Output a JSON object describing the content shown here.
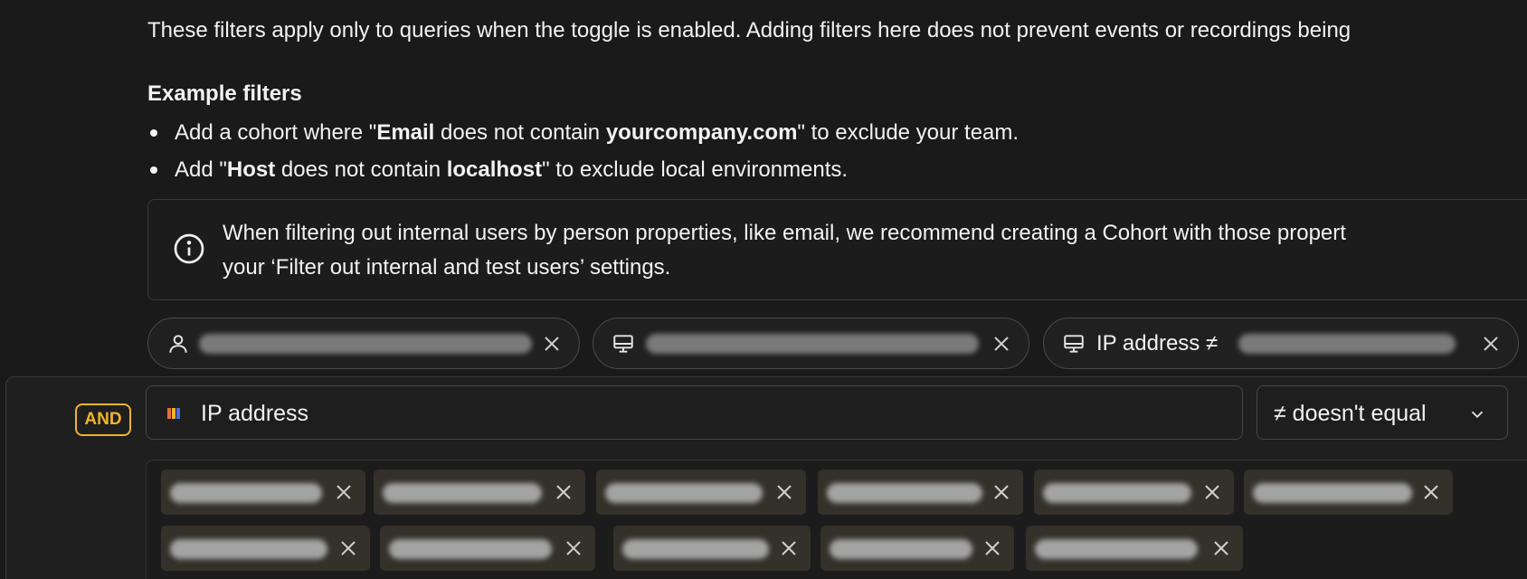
{
  "intro_text": "These filters apply only to queries when the toggle is enabled. Adding filters here does not prevent events or recordings being",
  "examples": {
    "title": "Example filters",
    "item1": {
      "pre": "Add a cohort where \"",
      "b1": "Email",
      "mid": " does not contain ",
      "b2": "yourcompany.com",
      "post": "\" to exclude your team."
    },
    "item2": {
      "pre": "Add \"",
      "b1": "Host",
      "mid": " does not contain ",
      "b2": "localhost",
      "post": "\" to exclude local environments."
    }
  },
  "info": {
    "line1": "When filtering out internal users by person properties, like email, we recommend creating a Cohort with those propert",
    "line2": "your ‘Filter out internal and test users’ settings."
  },
  "filter_pills": {
    "pill3_label": "IP address ≠"
  },
  "editor": {
    "and_label": "AND",
    "property_label": "IP address",
    "operator_label": "≠ doesn't equal"
  },
  "icons": {
    "person": "person-icon",
    "monitor": "monitor-icon",
    "close": "close-icon",
    "info": "info-icon",
    "chevron": "chevron-down-icon",
    "property": "property-icon"
  },
  "colors": {
    "background": "#1a1a1a",
    "and_accent": "#f0b429",
    "chip_bg": "#34312a"
  }
}
